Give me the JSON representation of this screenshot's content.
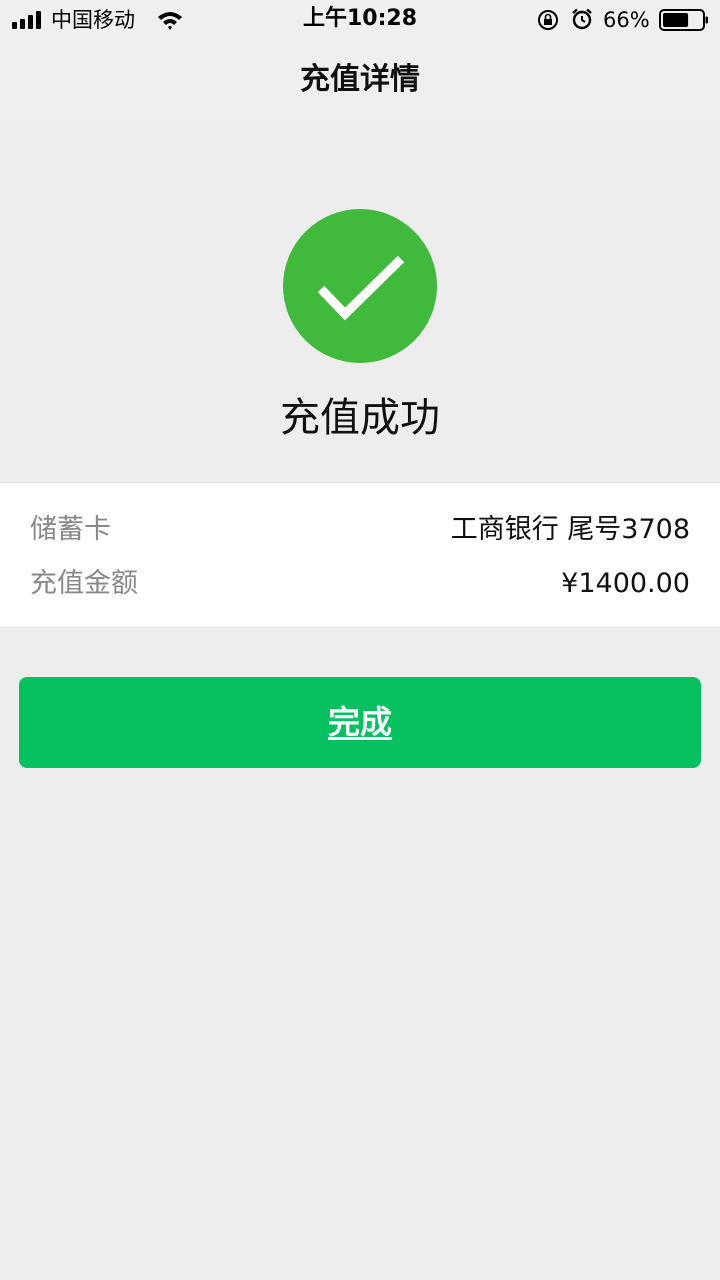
{
  "status_bar": {
    "carrier": "中国移动",
    "time": "上午10:28",
    "battery_percent": "66%",
    "battery_level": 0.66,
    "icons": [
      "signal-icon",
      "wifi-icon",
      "rotation-lock-icon",
      "alarm-icon",
      "battery-icon"
    ]
  },
  "nav": {
    "title": "充值详情"
  },
  "result": {
    "status_text": "充值成功",
    "icon": "checkmark-icon",
    "accent_color": "#40B93C"
  },
  "details": {
    "rows": [
      {
        "label": "储蓄卡",
        "value": "工商银行 尾号3708"
      },
      {
        "label": "充值金额",
        "value": "¥1400.00"
      }
    ]
  },
  "actions": {
    "done_label": "完成",
    "button_color": "#07C160"
  }
}
